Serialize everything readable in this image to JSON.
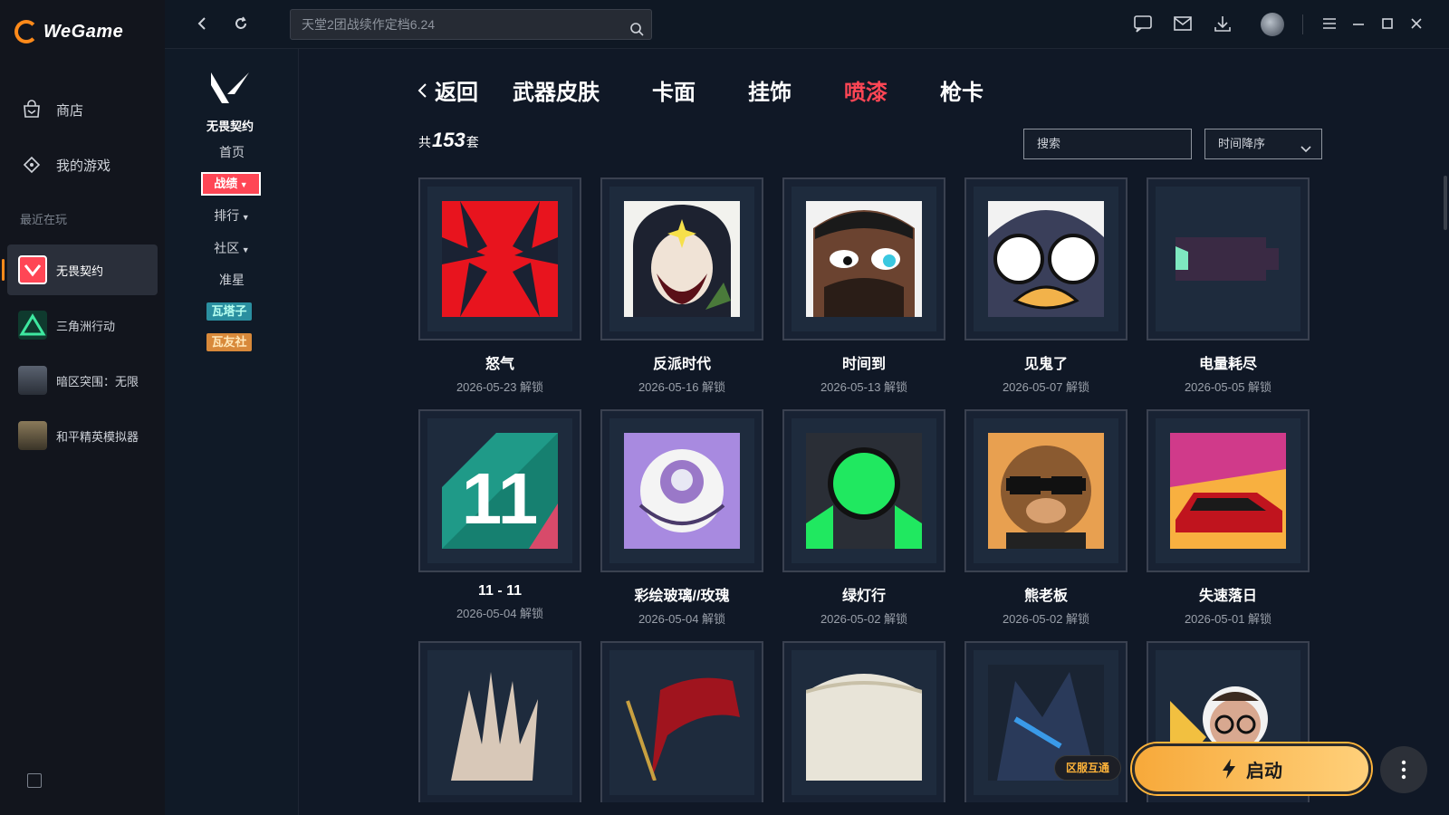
{
  "app": {
    "name": "WeGame"
  },
  "leftnav": {
    "items": [
      {
        "label": "商店"
      },
      {
        "label": "我的游戏"
      }
    ],
    "recent_label": "最近在玩",
    "recent": [
      {
        "label": "无畏契约",
        "active": true
      },
      {
        "label": "三角洲行动"
      },
      {
        "label": "暗区突围：无限"
      },
      {
        "label": "和平精英模拟器"
      }
    ]
  },
  "topbar": {
    "search_placeholder": "天堂2团战续作定档6.24"
  },
  "subnav": {
    "game_name": "无畏契约",
    "items": [
      "首页",
      "战绩",
      "排行",
      "社区",
      "准星"
    ],
    "tag_green": "瓦塔子",
    "tag_orange": "瓦友社"
  },
  "tabs": {
    "back": "返回",
    "items": [
      "武器皮肤",
      "卡面",
      "挂饰",
      "喷漆",
      "枪卡"
    ],
    "active": "喷漆"
  },
  "summary": {
    "prefix": "共",
    "count": "153",
    "suffix": "套"
  },
  "filters": {
    "search_placeholder": "搜索",
    "sort_value": "时间降序"
  },
  "items": [
    {
      "name": "怒气",
      "date": "2026-05-23 解锁",
      "icon": "anger-spray"
    },
    {
      "name": "反派时代",
      "date": "2026-05-16 解锁",
      "icon": "villain-spray"
    },
    {
      "name": "时间到",
      "date": "2026-05-13 解锁",
      "icon": "time-spray"
    },
    {
      "name": "见鬼了",
      "date": "2026-05-07 解锁",
      "icon": "penguin-spray"
    },
    {
      "name": "电量耗尽",
      "date": "2026-05-05 解锁",
      "icon": "battery-spray"
    },
    {
      "name": "11 - 11",
      "date": "2026-05-04 解锁",
      "icon": "eleven-spray"
    },
    {
      "name": "彩绘玻璃//玫瑰",
      "date": "2026-05-04 解锁",
      "icon": "rose-spray"
    },
    {
      "name": "绿灯行",
      "date": "2026-05-02 解锁",
      "icon": "greenlight-spray"
    },
    {
      "name": "熊老板",
      "date": "2026-05-02 解锁",
      "icon": "bear-spray"
    },
    {
      "name": "失速落日",
      "date": "2026-05-01 解锁",
      "icon": "car-spray"
    },
    {
      "name": "",
      "date": "",
      "icon": "hand-spray"
    },
    {
      "name": "",
      "date": "",
      "icon": "flag-spray"
    },
    {
      "name": "",
      "date": "",
      "icon": "cup-spray"
    },
    {
      "name": "",
      "date": "",
      "icon": "agent-spray"
    },
    {
      "name": "",
      "date": "",
      "icon": "glasses-spray"
    }
  ],
  "bottom": {
    "region_tag": "区服互通",
    "launch_label": "启动"
  },
  "colors": {
    "accent": "#ff4655",
    "launch": "#ffb43a",
    "bg": "#101826"
  }
}
